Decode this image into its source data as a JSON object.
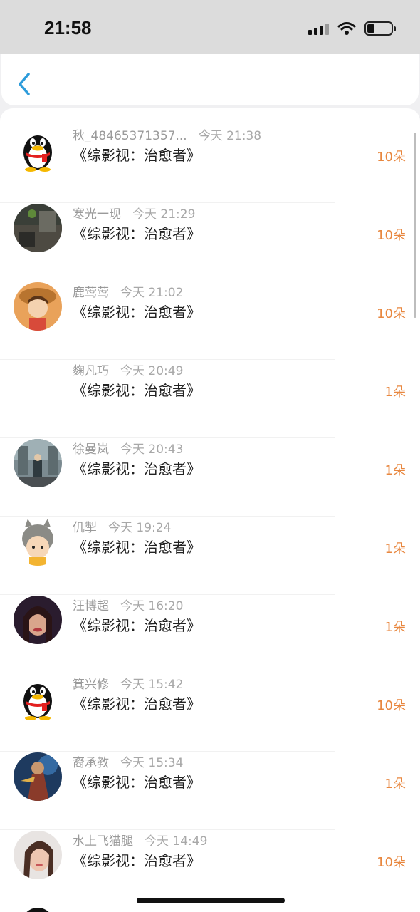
{
  "status_bar": {
    "time": "21:58"
  },
  "items": [
    {
      "name": "秋_48465371357...",
      "time": "今天 21:38",
      "title": "《综影视：治愈者》",
      "count": "10朵",
      "avatar": "qq-penguin"
    },
    {
      "name": "寒光一现",
      "time": "今天 21:29",
      "title": "《综影视：治愈者》",
      "count": "10朵",
      "avatar": "photo-dark"
    },
    {
      "name": "鹿莺莺",
      "time": "今天 21:02",
      "title": "《综影视：治愈者》",
      "count": "10朵",
      "avatar": "anime-girl"
    },
    {
      "name": "麴凡巧",
      "time": "今天 20:49",
      "title": "《综影视：治愈者》",
      "count": "1朵",
      "avatar": "none"
    },
    {
      "name": "徐曼岚",
      "time": "今天 20:43",
      "title": "《综影视：治愈者》",
      "count": "1朵",
      "avatar": "street-scene"
    },
    {
      "name": "仉掣",
      "time": "今天 19:24",
      "title": "《综影视：治愈者》",
      "count": "1朵",
      "avatar": "totoro-cartoon"
    },
    {
      "name": "汪博超",
      "time": "今天 16:20",
      "title": "《综影视：治愈者》",
      "count": "1朵",
      "avatar": "portrait-woman"
    },
    {
      "name": "箕兴修",
      "time": "今天 15:42",
      "title": "《综影视：治愈者》",
      "count": "10朵",
      "avatar": "qq-penguin"
    },
    {
      "name": "裔承教",
      "time": "今天 15:34",
      "title": "《综影视：治愈者》",
      "count": "1朵",
      "avatar": "game-hero"
    },
    {
      "name": "水上飞猫腿",
      "time": "今天 14:49",
      "title": "《综影视：治愈者》",
      "count": "10朵",
      "avatar": "photo-woman"
    }
  ],
  "colors": {
    "accent": "#2d9cdb",
    "count": "#e8873f"
  }
}
